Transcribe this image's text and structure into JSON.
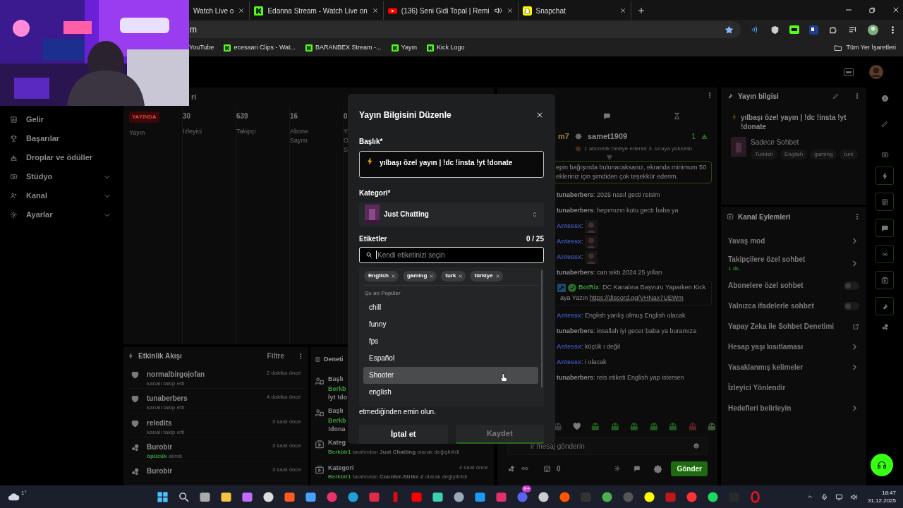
{
  "browser": {
    "tabs": [
      {
        "label": "Watch Live o"
      },
      {
        "label": "Edanna Stream - Watch Live on",
        "kind": "kick"
      },
      {
        "label": "(136) Seni Gidi Topal | Remi",
        "kind": "youtube",
        "audio": true
      },
      {
        "label": "Snapchat",
        "kind": "snapchat"
      }
    ],
    "address": "m",
    "bookmarks": [
      {
        "label": "YouTube"
      },
      {
        "label": "ecesaari Clips - Wat...",
        "kind": "kick"
      },
      {
        "label": "BARANBEX Stream -...",
        "kind": "kick"
      },
      {
        "label": "Yayın",
        "kind": "kick"
      },
      {
        "label": "Kick Logo",
        "kind": "kick"
      }
    ],
    "all_bookmarks": "Tüm Yer İşaretleri"
  },
  "sidebar": {
    "items": [
      {
        "label": "Gelir",
        "expandable": false
      },
      {
        "label": "Başarılar",
        "expandable": false
      },
      {
        "label": "Droplar ve ödüller",
        "expandable": false
      },
      {
        "label": "Stüdyo",
        "expandable": true
      },
      {
        "label": "Kanal",
        "expandable": true
      },
      {
        "label": "Ayarlar",
        "expandable": true
      }
    ]
  },
  "stats": {
    "title": "ri",
    "columns": [
      {
        "kind": "badge",
        "value": "YAYINDA",
        "label": [
          "Yayın"
        ]
      },
      {
        "kind": "number",
        "value": "30",
        "label": [
          "İzleyici"
        ]
      },
      {
        "kind": "number",
        "value": "639",
        "label": [
          "Takipçi"
        ]
      },
      {
        "kind": "number",
        "value": "16",
        "label": [
          "Abone",
          "Sayısı"
        ]
      },
      {
        "kind": "number",
        "value": "0",
        "label": [
          "Y",
          "O",
          "S"
        ]
      }
    ]
  },
  "activity": {
    "title": "Etkinlik Akışı",
    "filter": "Filtre",
    "items": [
      {
        "kind": "follow",
        "name": "normalbirgojofan",
        "action": "kanalı takip etti",
        "time": "2 dakika önce"
      },
      {
        "kind": "follow",
        "name": "tunaberbers",
        "action": "kanalı takip etti",
        "time": "4 dakika önce"
      },
      {
        "kind": "follow",
        "name": "reledits",
        "action": "kanalı takip etti",
        "time": "3 saat önce"
      },
      {
        "kind": "kicks",
        "name": "Burobir",
        "highlight": "öpücük",
        "action": "alındı",
        "time": "3 saat önce"
      },
      {
        "kind": "kicks",
        "name": "Burobir",
        "time": "3 saat önce"
      }
    ]
  },
  "moderation": {
    "title": "Deneti",
    "items": [
      {
        "kind": "title",
        "title": "Başlı",
        "by": "Berkb",
        "detail": "lyt !do"
      },
      {
        "kind": "title",
        "title": "Başlı",
        "by": "Berkb",
        "detail": "!dona"
      },
      {
        "kind": "category",
        "title": "Kateg",
        "by": "Berkbir1",
        "line": "tarafından **Just Chatting** olarak değiştirildi"
      },
      {
        "kind": "category",
        "title": "Kategori",
        "time": "4 saat önce",
        "by": "Berkbir1",
        "line": "tarafından **Counter-Strike 2** olarak değiştirildi"
      }
    ]
  },
  "chat": {
    "gifters": [
      {
        "name": "m7"
      },
      {
        "name": "samet1909",
        "count": "1"
      }
    ],
    "gift_hint": "1 abonelik hediye ederek 3. sıraya yükselin",
    "pinned": [
      "epin bağışında bulunacaksanız, ekranda minimum 50",
      "ekleriniz için şimdiden çok teşekkür ederim."
    ],
    "messages": [
      {
        "kind": "text",
        "user": "tunaberbers",
        "color": "#8a8a8a",
        "text": ": 2025 nasıl gecti reisim"
      },
      {
        "kind": "text",
        "user": "tunaberbers",
        "color": "#8a8a8a",
        "text": ": hepımızın kotu gectı baba ya"
      },
      {
        "kind": "emote",
        "user": "Antessx",
        "color": "#3a52b0",
        "text": ":"
      },
      {
        "kind": "emote",
        "user": "Antessx",
        "color": "#3a52b0",
        "text": ":"
      },
      {
        "kind": "emote",
        "user": "Antessx",
        "color": "#3a52b0",
        "text": ":"
      },
      {
        "kind": "text",
        "user": "tunaberbers",
        "color": "#8a8a8a",
        "text": ": can sıktı 2024 25 yılları"
      },
      {
        "kind": "bot",
        "user": "BotRix",
        "color": "#3a9a3a",
        "text": ": DC Kanalına Başvuru Yaparken Kick",
        "text2": "aya Yazın",
        "link": "https://discord.gg/VHNax7UEWm"
      },
      {
        "kind": "text",
        "user": "Antessx",
        "color": "#3a52b0",
        "text": ": English yanlış olmuş English olacak"
      },
      {
        "kind": "text",
        "user": "tunaberbers",
        "color": "#8a8a8a",
        "text": ": insallah iyi gecer baba ya buramıza"
      },
      {
        "kind": "text",
        "user": "Antessx",
        "color": "#3a52b0",
        "text": ": küçük ı değil"
      },
      {
        "kind": "text",
        "user": "Antessx",
        "color": "#3a52b0",
        "text": ": i olacak"
      },
      {
        "kind": "text",
        "user": "tunaberbers",
        "color": "#8a8a8a",
        "text": ": reis etiketi English yap istersen"
      }
    ],
    "input_placeholder": "ir mesaj gönderin",
    "points": "0",
    "send": "Gönder"
  },
  "stream_info": {
    "title": "Yayın bilgisi",
    "stream_title": "yılbaşı özel yayın | !dc !insta !yt !donate",
    "category": "Sadece Sohbet",
    "tags": [
      "Turkish",
      "English",
      "gaming",
      "turk"
    ]
  },
  "channel_actions": {
    "title": "Kanal Eylemleri",
    "items": [
      {
        "kind": "link",
        "label": "Yavaş mod"
      },
      {
        "kind": "link",
        "label": "Takipçilere özel sohbet",
        "sub": "1 dk."
      },
      {
        "kind": "toggle",
        "label": "Abonelere özel sohbet",
        "on": false
      },
      {
        "kind": "toggle",
        "label": "Yalnızca ifadelerle sohbet",
        "on": false
      },
      {
        "kind": "external",
        "label": "Yapay Zeka ile Sohbet Denetimi"
      },
      {
        "kind": "link",
        "label": "Hesap yaşı kısıtlaması"
      },
      {
        "kind": "link",
        "label": "Yasaklanmış kelimeler"
      },
      {
        "kind": "plain",
        "label": "İzleyici Yönlendir"
      },
      {
        "kind": "link",
        "label": "Hedefleri belirleyin"
      }
    ]
  },
  "dialog": {
    "title": "Yayın Bilgisini Düzenle",
    "title_label": "Başlık*",
    "title_value": "yılbaşı özel yayın | !dc !insta !yt !donate",
    "category_label": "Kategori*",
    "category_value": "Just Chatting",
    "tags_label": "Etiketler",
    "tags_count": "0 / 25",
    "tags_placeholder": "Kendi etiketinizi seçin",
    "chips": [
      "English",
      "gaming",
      "turk",
      "türkiye"
    ],
    "popular_label": "Şu an Popüler",
    "options": [
      {
        "label": "chill",
        "selected": false
      },
      {
        "label": "funny",
        "selected": false
      },
      {
        "label": "fps",
        "selected": false
      },
      {
        "label": "Español",
        "selected": false
      },
      {
        "label": "Shooter",
        "selected": true
      },
      {
        "label": "english",
        "selected": false
      }
    ],
    "note": "etmediğinden emin olun.",
    "cancel": "İptal et",
    "save": {
      "label": "Kaydet",
      "disabled": true
    }
  },
  "taskbar": {
    "weather": "1°",
    "discord_badge": "9+",
    "time": "18:47",
    "date": "31.12.2025"
  }
}
